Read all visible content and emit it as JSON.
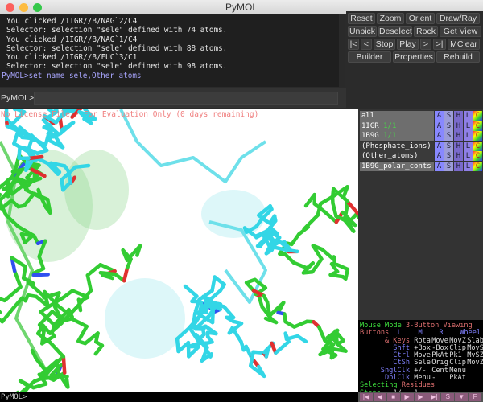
{
  "window": {
    "title": "PyMOL"
  },
  "console": {
    "lines": [
      "You clicked /1IGR//B/NAG`2/C4",
      "Selector: selection \"sele\" defined with 74 atoms.",
      "You clicked /1IGR//B/NAG`1/C4",
      "Selector: selection \"sele\" defined with 88 atoms.",
      "You clicked /1IGR//B/FUC`3/C1",
      "Selector: selection \"sele\" defined with 98 atoms."
    ],
    "last_command": "PyMOL>set_name sele,Other_atoms"
  },
  "command": {
    "label": "PyMOL>",
    "value": ""
  },
  "buttons": {
    "row1": [
      "Reset",
      "Zoom",
      "Orient",
      "Draw/Ray"
    ],
    "row2": [
      "Unpick",
      "Deselect",
      "Rock",
      "Get View"
    ],
    "row3": [
      "|<",
      "<",
      "Stop",
      "Play",
      ">",
      ">|",
      "MClear"
    ],
    "row4": [
      "Builder",
      "Properties",
      "Rebuild"
    ]
  },
  "viewer": {
    "license": "No License File - For Evaluation Only (0 days remaining)"
  },
  "objects": [
    {
      "name": "all",
      "state": ""
    },
    {
      "name": "1IGR",
      "state": "1/1"
    },
    {
      "name": "1B9G",
      "state": "1/1"
    },
    {
      "name": "(Phosphate_ions)",
      "state": ""
    },
    {
      "name": "(Other_atoms)",
      "state": ""
    },
    {
      "name": "1B9G_polar_conts",
      "state": ""
    }
  ],
  "object_buttons": [
    "A",
    "S",
    "H",
    "L",
    "C"
  ],
  "mouse": {
    "title": "Mouse Mode",
    "mode": "3-Button Viewing",
    "buttons_label": "Buttons",
    "keys_label": "& Keys",
    "cols": [
      "L",
      "M",
      "R",
      "Wheel"
    ],
    "rows": [
      {
        "k": "",
        "v": [
          "Rota",
          "Move",
          "MovZ",
          "Slab"
        ]
      },
      {
        "k": "Shft",
        "v": [
          "+Box",
          "-Box",
          "Clip",
          "MovS"
        ]
      },
      {
        "k": "Ctrl",
        "v": [
          "Move",
          "PkAt",
          "Pk1",
          "MvSZ"
        ]
      },
      {
        "k": "CtSh",
        "v": [
          "Sele",
          "Orig",
          "Clip",
          "MovZ"
        ]
      },
      {
        "k": "SnglClk",
        "v": [
          "+/-",
          "Cent",
          "Menu",
          ""
        ]
      },
      {
        "k": "DblClk",
        "v": [
          "Menu",
          "-",
          "PkAt",
          ""
        ]
      }
    ],
    "selecting": "Selecting",
    "selecting_what": "Residues",
    "state_label": "State",
    "state_value": "1/",
    "state_total": "1"
  },
  "controls": [
    "|◀",
    "◀",
    "■",
    "▶",
    "▶",
    "▶|",
    "S",
    "▼",
    "F"
  ],
  "bottom_prompt": "PyMOL>_",
  "colors": {
    "cyan": "#33d6e6",
    "green": "#33cc33",
    "bg": "#ffffff"
  }
}
